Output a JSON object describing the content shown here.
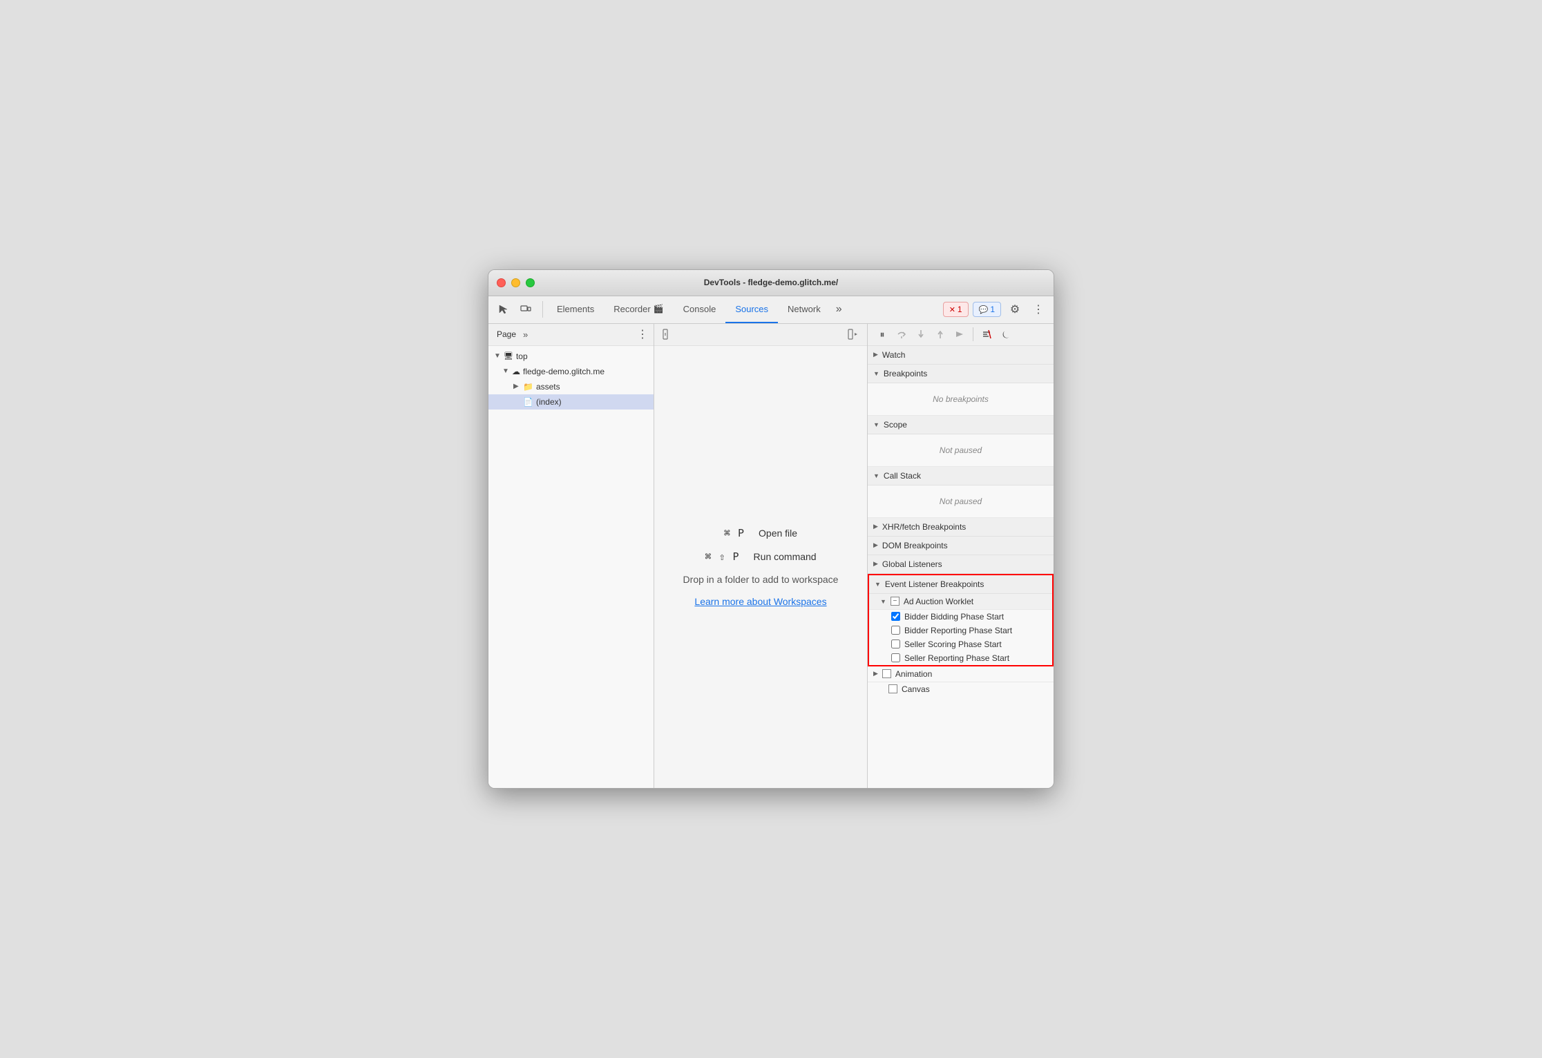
{
  "window": {
    "title": "DevTools - fledge-demo.glitch.me/"
  },
  "toolbar": {
    "tabs": [
      {
        "id": "elements",
        "label": "Elements",
        "active": false
      },
      {
        "id": "recorder",
        "label": "Recorder 🎬",
        "active": false
      },
      {
        "id": "console",
        "label": "Console",
        "active": false
      },
      {
        "id": "sources",
        "label": "Sources",
        "active": true
      },
      {
        "id": "network",
        "label": "Network",
        "active": false
      }
    ],
    "more_tabs_label": "»",
    "error_badge": "1",
    "info_badge": "1",
    "gear_icon": "⚙",
    "more_icon": "⋮"
  },
  "left_panel": {
    "tab_label": "Page",
    "more_label": "»",
    "dots_label": "⋮",
    "tree": [
      {
        "id": "top",
        "label": "top",
        "indent": 0,
        "arrow": "▼",
        "icon": "🖥"
      },
      {
        "id": "fledge-demo",
        "label": "fledge-demo.glitch.me",
        "indent": 1,
        "arrow": "▼",
        "icon": "☁"
      },
      {
        "id": "assets",
        "label": "assets",
        "indent": 2,
        "arrow": "▶",
        "icon": "📁"
      },
      {
        "id": "index",
        "label": "(index)",
        "indent": 2,
        "arrow": "",
        "icon": "📄",
        "selected": true
      }
    ]
  },
  "editor": {
    "shortcut1_keys": "⌘ P",
    "shortcut1_label": "Open file",
    "shortcut2_keys": "⌘ ⇧ P",
    "shortcut2_label": "Run command",
    "workspace_text": "Drop in a folder to add to workspace",
    "workspace_link": "Learn more about Workspaces"
  },
  "right_panel": {
    "debugger_buttons": [
      {
        "id": "pause",
        "icon": "⏸",
        "active": false
      },
      {
        "id": "step-over",
        "icon": "↺",
        "active": false
      },
      {
        "id": "step-into",
        "icon": "↓",
        "active": false
      },
      {
        "id": "step-out",
        "icon": "↑",
        "active": false
      },
      {
        "id": "step",
        "icon": "→",
        "active": false
      },
      {
        "id": "deactivate",
        "icon": "⊘",
        "active": false
      },
      {
        "id": "async",
        "icon": "⏾",
        "active": false
      }
    ],
    "sections": [
      {
        "id": "watch",
        "label": "Watch",
        "arrow": "▶",
        "collapsed": true
      },
      {
        "id": "breakpoints",
        "label": "Breakpoints",
        "arrow": "▼",
        "collapsed": false,
        "empty_text": "No breakpoints"
      },
      {
        "id": "scope",
        "label": "Scope",
        "arrow": "▼",
        "collapsed": false,
        "empty_text": "Not paused"
      },
      {
        "id": "call-stack",
        "label": "Call Stack",
        "arrow": "▼",
        "collapsed": false,
        "empty_text": "Not paused"
      },
      {
        "id": "xhr-fetch",
        "label": "XHR/fetch Breakpoints",
        "arrow": "▶",
        "collapsed": true
      },
      {
        "id": "dom-breakpoints",
        "label": "DOM Breakpoints",
        "arrow": "▶",
        "collapsed": true
      },
      {
        "id": "global-listeners",
        "label": "Global Listeners",
        "arrow": "▶",
        "collapsed": true
      },
      {
        "id": "event-listener",
        "label": "Event Listener Breakpoints",
        "arrow": "▼",
        "highlighted": true,
        "sub_sections": [
          {
            "id": "ad-auction",
            "label": "Ad Auction Worklet",
            "arrow": "▼",
            "checkboxes": [
              {
                "id": "bidder-bidding",
                "label": "Bidder Bidding Phase Start",
                "checked": true
              },
              {
                "id": "bidder-reporting",
                "label": "Bidder Reporting Phase Start",
                "checked": false
              },
              {
                "id": "seller-scoring",
                "label": "Seller Scoring Phase Start",
                "checked": false
              },
              {
                "id": "seller-reporting",
                "label": "Seller Reporting Phase Start",
                "checked": false
              }
            ]
          }
        ]
      },
      {
        "id": "animation",
        "label": "Animation",
        "arrow": "▶",
        "collapsed": true
      },
      {
        "id": "canvas",
        "label": "Canvas",
        "arrow": "",
        "checkbox": true
      }
    ]
  }
}
